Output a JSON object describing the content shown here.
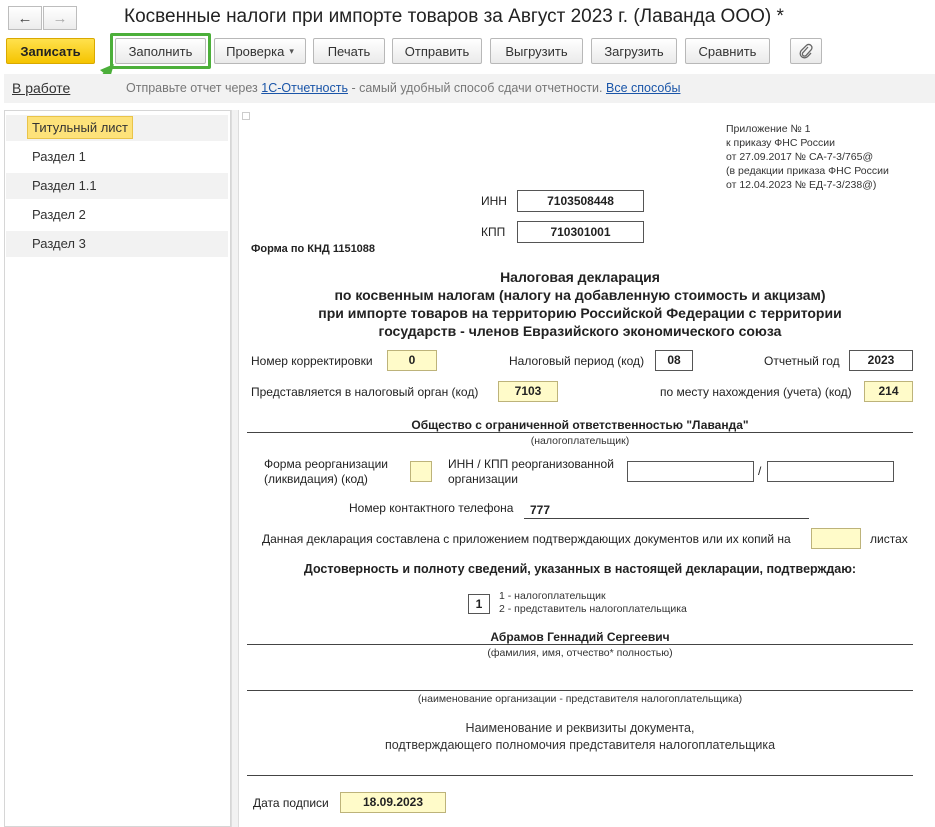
{
  "window": {
    "title": "Косвенные налоги при импорте товаров за Август 2023 г. (Лаванда ООО) *",
    "back_label": "←",
    "forward_label": "→"
  },
  "toolbar": {
    "save_label": "Записать",
    "fill_label": "Заполнить",
    "check_label": "Проверка",
    "check_arrow": "▾",
    "print_label": "Печать",
    "send_label": "Отправить",
    "export_label": "Выгрузить",
    "import_label": "Загрузить",
    "compare_label": "Сравнить",
    "attach_icon": "paperclip-icon"
  },
  "infobar": {
    "status_link": "В работе",
    "text_before": "Отправьте отчет через ",
    "link1": "1С-Отчетность",
    "text_mid": " - самый удобный способ сдачи отчетности. ",
    "link2": "Все способы"
  },
  "sections": [
    {
      "label": "Титульный лист"
    },
    {
      "label": "Раздел 1"
    },
    {
      "label": "Раздел 1.1"
    },
    {
      "label": "Раздел 2"
    },
    {
      "label": "Раздел 3"
    }
  ],
  "form": {
    "appendix": [
      "Приложение № 1",
      "к приказу ФНС России",
      "от 27.09.2017 № СА-7-3/765@",
      "(в редакции приказа ФНС России",
      "от 12.04.2023 № ЕД-7-3/238@)"
    ],
    "inn_label": "ИНН",
    "inn_value": "7103508448",
    "kpp_label": "КПП",
    "kpp_value": "710301001",
    "knd": "Форма по КНД 1151088",
    "heading": [
      "Налоговая декларация",
      "по косвенным налогам (налогу на добавленную стоимость и акцизам)",
      "при импорте товаров на территорию Российской Федерации с территории",
      "государств - членов Евразийского экономического союза"
    ],
    "correction_label": "Номер корректировки",
    "correction_value": "0",
    "period_label": "Налоговый период (код)",
    "period_value": "08",
    "year_label": "Отчетный год",
    "year_value": "2023",
    "authority_label": "Представляется в налоговый орган (код)",
    "authority_value": "7103",
    "location_label": "по месту нахождения (учета) (код)",
    "location_value": "214",
    "org_name": "Общество с ограниченной ответственностью \"Лаванда\"",
    "org_caption": "(налогоплательщик)",
    "reorg_label_1": "Форма реорганизации",
    "reorg_label_2": "(ликвидация) (код)",
    "reorg_value": "",
    "reorg_innkpp_1": "ИНН / КПП реорганизованной",
    "reorg_innkpp_2": "организации",
    "slash": "/",
    "phone_label": "Номер контактного телефона",
    "phone_value": "777",
    "docs_label": "Данная декларация составлена с приложением подтверждающих документов или их копий на",
    "docs_value": "",
    "docs_suffix": "листах",
    "confirm_heading": "Достоверность и полноту сведений, указанных в настоящей декларации, подтверждаю:",
    "signer_value": "1",
    "signer_opt1": "1 - налогоплательщик",
    "signer_opt2": "2 - представитель налогоплательщика",
    "signer_name": "Абрамов Геннадий Сергеевич",
    "signer_caption": "(фамилия, имя, отчество* полностью)",
    "rep_org_caption": "(наименование организации - представителя налогоплательщика)",
    "rep_doc_1": "Наименование и реквизиты документа,",
    "rep_doc_2": "подтверждающего полномочия представителя налогоплательщика",
    "date_label": "Дата подписи",
    "date_value": "18.09.2023"
  },
  "colors": {
    "primary_button": "#f5c400",
    "highlight": "#4caf3a",
    "link": "#1a55a8",
    "selected_section": "#fde27a",
    "field_fill": "#fffbc9"
  }
}
